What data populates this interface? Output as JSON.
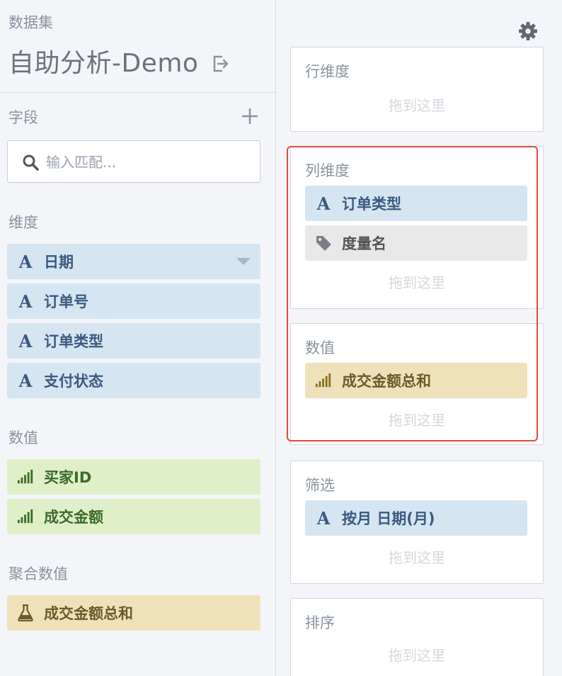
{
  "dataset": {
    "label": "数据集",
    "title": "自助分析-Demo"
  },
  "fields": {
    "label": "字段",
    "search_placeholder": "输入匹配..."
  },
  "dimensions": {
    "label": "维度",
    "items": [
      {
        "name": "日期",
        "has_menu": true
      },
      {
        "name": "订单号"
      },
      {
        "name": "订单类型"
      },
      {
        "name": "支付状态"
      }
    ]
  },
  "measures": {
    "label": "数值",
    "items": [
      {
        "name": "买家ID"
      },
      {
        "name": "成交金额"
      }
    ]
  },
  "aggregates": {
    "label": "聚合数值",
    "items": [
      {
        "name": "成交金额总和"
      }
    ]
  },
  "shelves": {
    "rows": {
      "title": "行维度",
      "hint": "拖到这里"
    },
    "columns": {
      "title": "列维度",
      "hint": "拖到这里",
      "items": [
        {
          "name": "订单类型"
        },
        {
          "name": "度量名"
        }
      ]
    },
    "values": {
      "title": "数值",
      "hint": "拖到这里",
      "items": [
        {
          "name": "成交金额总和"
        }
      ]
    },
    "filters": {
      "title": "筛选",
      "hint": "拖到这里",
      "items": [
        {
          "name": "按月 日期(月)"
        }
      ]
    },
    "sort": {
      "title": "排序",
      "hint": "拖到这里"
    }
  },
  "colors": {
    "dimension_bg": "#d5e5f2",
    "measure_bg": "#dff0c8",
    "aggregate_bg": "#efe2bb",
    "measure_name_bg": "#e8e8e8",
    "highlight_border": "#e04b3a"
  },
  "icons": {
    "dimension": "letter-a-icon",
    "measure": "signal-bars-icon",
    "aggregate": "flask-icon",
    "measure_name": "tag-icon",
    "exit": "exit-icon",
    "add": "plus-icon",
    "search": "search-icon",
    "settings": "gear-icon"
  }
}
